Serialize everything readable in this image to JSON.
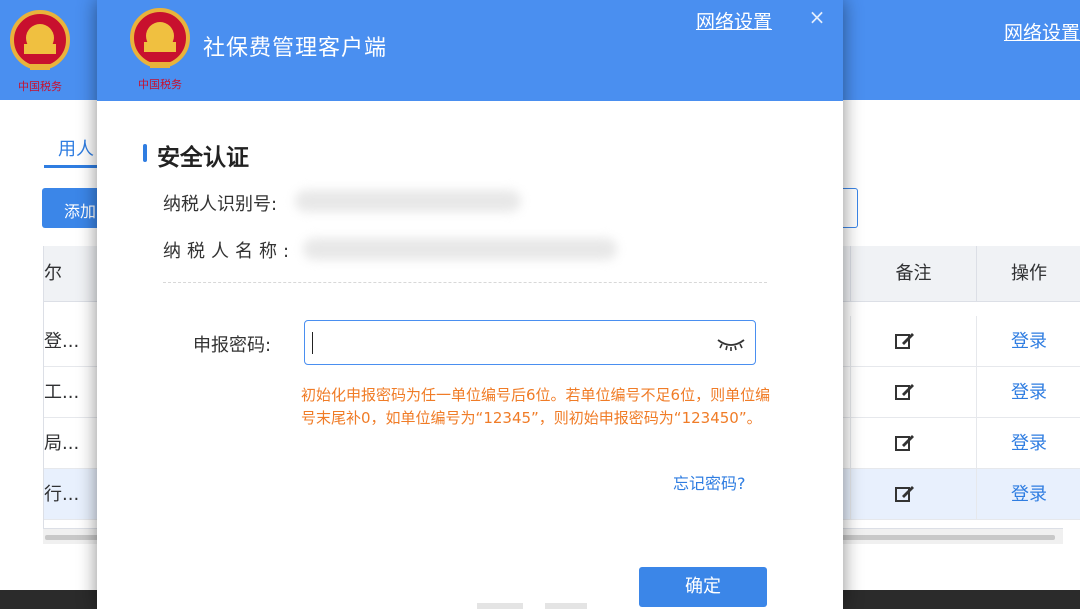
{
  "background_app": {
    "network_settings": "网络设置",
    "tab_label": "用人",
    "add_button_label": "添加",
    "table": {
      "headers": {
        "name": "尔",
        "note": "备注",
        "action": "操作"
      },
      "rows": [
        {
          "name": "登...",
          "action": "登录"
        },
        {
          "name": "工...",
          "action": "登录"
        },
        {
          "name": "局...",
          "action": "登录"
        },
        {
          "name": "行...",
          "action": "登录"
        }
      ]
    }
  },
  "dialog": {
    "title": "社保费管理客户端",
    "network_settings": "网络设置",
    "close": "×",
    "section_title": "安全认证",
    "taxpayer_id_label": "纳税人识别号:",
    "taxpayer_name_label": "纳税人名称:",
    "password_label": "申报密码:",
    "password_value": "",
    "hint": "初始化申报密码为任一单位编号后6位。若单位编号不足6位，则单位编号末尾补0，如单位编号为“12345”，则初始申报密码为“123450”。",
    "forgot_password": "忘记密码?",
    "confirm": "确定"
  },
  "icons": {
    "logo": "tax-emblem-icon",
    "eye": "eye-closed-icon",
    "edit": "edit-icon",
    "close": "close-icon"
  },
  "colors": {
    "header_blue": "#4a8ff0",
    "accent_blue": "#2f7de1",
    "hint_orange": "#f07c27"
  }
}
